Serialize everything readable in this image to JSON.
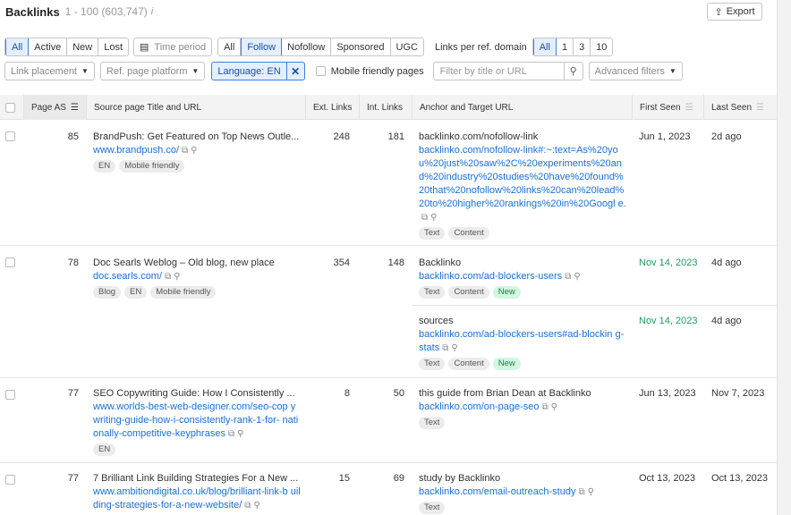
{
  "header": {
    "title": "Backlinks",
    "count": "1 - 100 (603,747)",
    "info": "i",
    "export_label": "Export"
  },
  "filters_row1": {
    "type_tabs": [
      "All",
      "Active",
      "New",
      "Lost"
    ],
    "time_period": "Time period",
    "follow_tabs": [
      "All",
      "Follow",
      "Nofollow",
      "Sponsored",
      "UGC"
    ],
    "links_per_domain_label": "Links per ref. domain",
    "links_per_domain_options": [
      "All",
      "1",
      "3",
      "10"
    ]
  },
  "filters_row2": {
    "link_placement": "Link placement",
    "ref_page_platform": "Ref. page platform",
    "language": "Language: EN",
    "mobile_friendly": "Mobile friendly pages",
    "search_placeholder": "Filter by title or URL",
    "advanced_filters": "Advanced filters"
  },
  "columns": {
    "page_as": "Page AS",
    "source": "Source page Title and URL",
    "ext_links": "Ext. Links",
    "int_links": "Int. Links",
    "anchor": "Anchor and Target URL",
    "first_seen": "First Seen",
    "last_seen": "Last Seen"
  },
  "rows": [
    {
      "page_as": "85",
      "title": "BrandPush: Get Featured on Top News Outle...",
      "url": "www.brandpush.co/",
      "tags": [
        "EN",
        "Mobile friendly"
      ],
      "ext_links": "248",
      "int_links": "181",
      "anchors": [
        {
          "anchor": "backlinko.com/nofollow-link",
          "target": "backlinko.com/nofollow-link#:~:text=As%20yo u%20just%20saw%2C%20experiments%20an d%20industry%20studies%20have%20found% 20that%20nofollow%20links%20can%20lead% 20to%20higher%20rankings%20in%20Googl e.",
          "tags": [
            "Text",
            "Content"
          ],
          "first_seen": "Jun 1, 2023",
          "last_seen": "2d ago",
          "first_green": false
        }
      ]
    },
    {
      "page_as": "78",
      "title": "Doc Searls Weblog – Old blog, new place",
      "url": "doc.searls.com/",
      "tags": [
        "Blog",
        "EN",
        "Mobile friendly"
      ],
      "ext_links": "354",
      "int_links": "148",
      "anchors": [
        {
          "anchor": "Backlinko",
          "target": "backlinko.com/ad-blockers-users",
          "tags": [
            "Text",
            "Content",
            "New"
          ],
          "first_seen": "Nov 14, 2023",
          "last_seen": "4d ago",
          "first_green": true
        },
        {
          "anchor": "sources",
          "target": "backlinko.com/ad-blockers-users#ad-blockin g-stats",
          "tags": [
            "Text",
            "Content",
            "New"
          ],
          "first_seen": "Nov 14, 2023",
          "last_seen": "4d ago",
          "first_green": true
        }
      ]
    },
    {
      "page_as": "77",
      "title": "SEO Copywriting Guide: How I Consistently ...",
      "url": "www.worlds-best-web-designer.com/seo-cop ywriting-guide-how-i-consistently-rank-1-for- nationally-competitive-keyphrases",
      "tags": [
        "EN"
      ],
      "ext_links": "8",
      "int_links": "50",
      "anchors": [
        {
          "anchor": "this guide from Brian Dean at Backlinko",
          "target": "backlinko.com/on-page-seo",
          "tags": [
            "Text"
          ],
          "first_seen": "Jun 13, 2023",
          "last_seen": "Nov 7, 2023",
          "first_green": false
        }
      ]
    },
    {
      "page_as": "77",
      "title": "7 Brilliant Link Building Strategies For a New ...",
      "url": "www.ambitiondigital.co.uk/blog/brilliant-link-b uilding-strategies-for-a-new-website/",
      "tags": [],
      "ext_links": "15",
      "int_links": "69",
      "anchors": [
        {
          "anchor": "study by Backlinko",
          "target": "backlinko.com/email-outreach-study",
          "tags": [
            "Text"
          ],
          "first_seen": "Oct 13, 2023",
          "last_seen": "Oct 13, 2023",
          "first_green": false
        }
      ]
    }
  ],
  "colors": {
    "accent": "#3d7fe1",
    "link": "#1a6fd6",
    "green": "#1d9b5a"
  }
}
